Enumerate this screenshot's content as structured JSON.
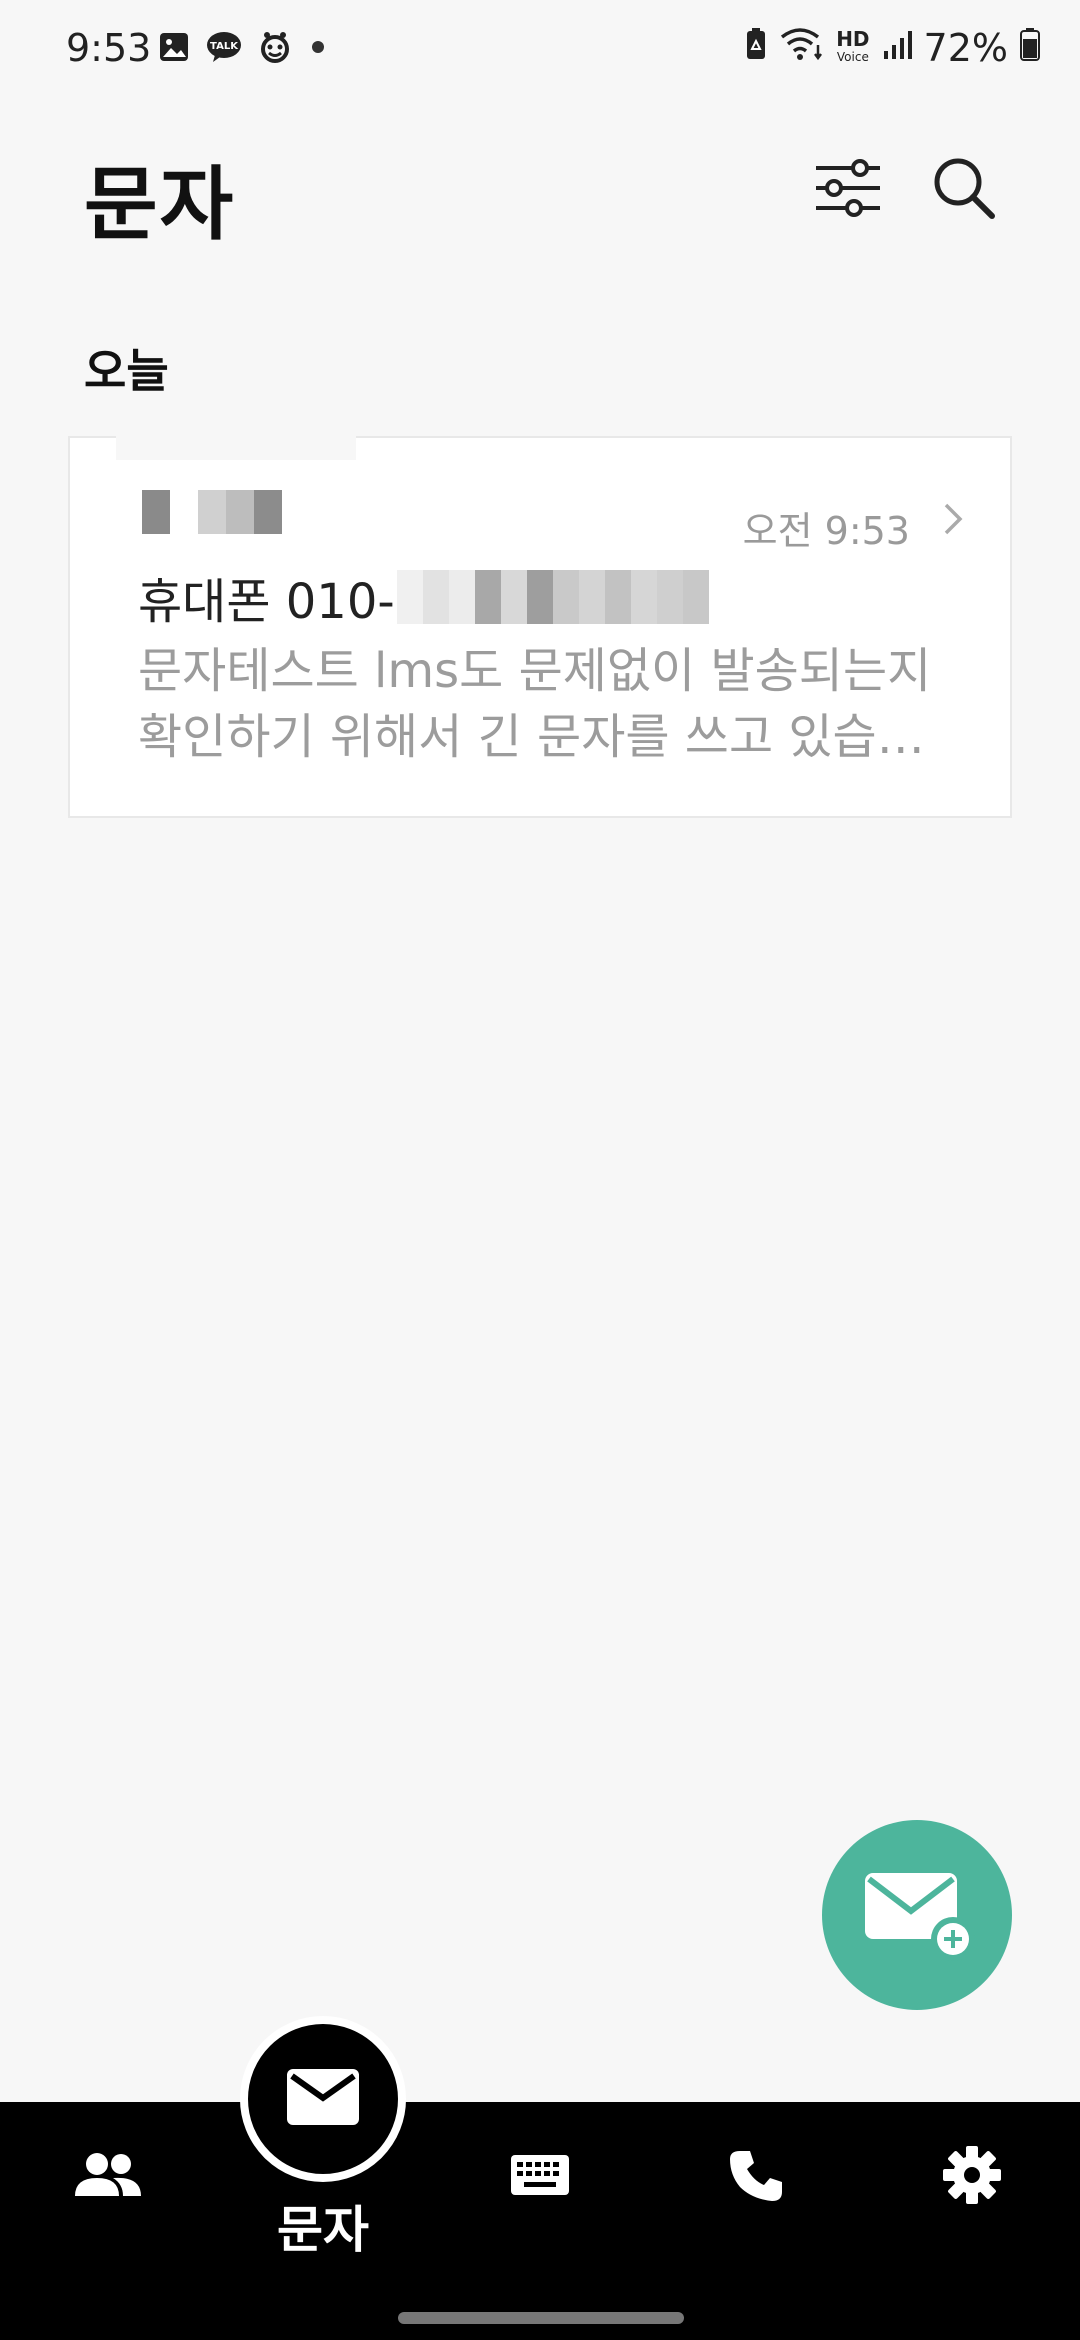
{
  "status_bar": {
    "time": "9:53",
    "battery": "72%",
    "left_icons": [
      "gallery-icon",
      "kakaotalk-icon",
      "app-icon",
      "dot-icon"
    ],
    "right_icons": [
      "battery-saver-icon",
      "wifi-icon",
      "hd-voice-icon",
      "signal-icon",
      "battery-icon"
    ],
    "hd_label": "HD",
    "voice_label": "Voice"
  },
  "header": {
    "title": "문자",
    "filter_icon": "filter-sliders-icon",
    "search_icon": "search-icon"
  },
  "section": {
    "title": "오늘"
  },
  "messages": [
    {
      "time": "오전 9:53",
      "phone_prefix": "휴대폰 010-",
      "preview_line1": "문자테스트 lms도 문제없이 발송되는지",
      "preview_line2": "확인하기 위해서 긴 문자를 쓰고 있습…"
    }
  ],
  "fab": {
    "icon": "compose-message-icon"
  },
  "bottom_nav": {
    "items": [
      {
        "icon": "contacts-icon"
      },
      {
        "icon": "message-icon",
        "label": "문자",
        "active": true
      },
      {
        "icon": "keypad-icon"
      },
      {
        "icon": "phone-icon"
      },
      {
        "icon": "settings-icon"
      }
    ],
    "active_label": "문자"
  },
  "colors": {
    "accent": "#4db59c",
    "nav_bg": "#000000",
    "background": "#f7f7f7"
  }
}
